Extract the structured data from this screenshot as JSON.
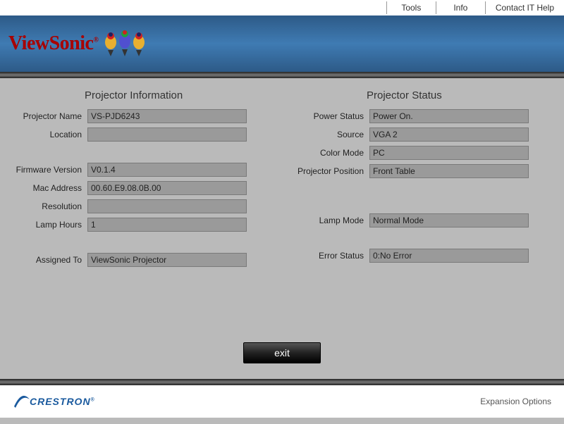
{
  "topbar": {
    "tools": "Tools",
    "info": "Info",
    "contact": "Contact IT Help"
  },
  "brand": "ViewSonic",
  "sections": {
    "info_title": "Projector Information",
    "status_title": "Projector Status"
  },
  "info": {
    "projector_name_lbl": "Projector Name",
    "projector_name_val": "VS-PJD6243",
    "location_lbl": "Location",
    "location_val": "",
    "firmware_lbl": "Firmware Version",
    "firmware_val": "V0.1.4",
    "mac_lbl": "Mac Address",
    "mac_val": "00.60.E9.08.0B.00",
    "resolution_lbl": "Resolution",
    "resolution_val": "",
    "lamp_hours_lbl": "Lamp Hours",
    "lamp_hours_val": "1",
    "assigned_lbl": "Assigned To",
    "assigned_val": "ViewSonic Projector"
  },
  "status": {
    "power_lbl": "Power Status",
    "power_val": "Power On.",
    "source_lbl": "Source",
    "source_val": "VGA 2",
    "color_lbl": "Color Mode",
    "color_val": "PC",
    "pos_lbl": "Projector Position",
    "pos_val": "Front Table",
    "lamp_mode_lbl": "Lamp Mode",
    "lamp_mode_val": "Normal Mode",
    "error_lbl": "Error Status",
    "error_val": "0:No Error"
  },
  "buttons": {
    "exit": "exit"
  },
  "footer": {
    "exp": "Expansion Options"
  }
}
